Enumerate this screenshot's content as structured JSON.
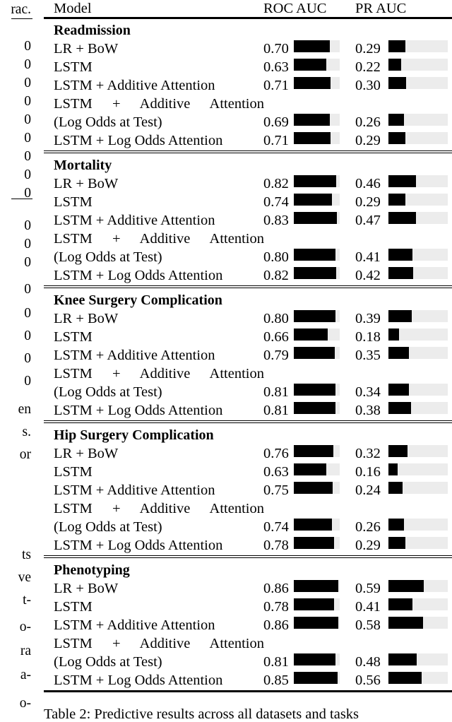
{
  "page": {
    "left_margin_column": {
      "header_fragment": "rac.",
      "value_fragments": [
        "0",
        "0",
        "0",
        "0",
        "0",
        "0",
        "0",
        "0",
        "0",
        "0",
        "0",
        "0",
        "0",
        "0",
        "0",
        "0",
        "0"
      ],
      "text_fragments": [
        "en",
        "s.",
        "or",
        "ts",
        "ve",
        "t-",
        "o-",
        "ra",
        "a-",
        "o-"
      ]
    },
    "caption": "Table 2: Predictive results across all datasets and tasks"
  },
  "table": {
    "columns": {
      "model": "Model",
      "roc_auc": "ROC AUC",
      "pr_auc": "PR AUC"
    },
    "bar_scale": {
      "roc_max": 0.885,
      "pr_max": 1.0,
      "track_color": "#ececec",
      "fill_color": "#000000"
    },
    "model_names": {
      "lr_bow": "LR + BoW",
      "lstm": "LSTM",
      "lstm_additive": "LSTM + Additive Attention",
      "lstm_additive_logodds_line1": "LSTM + Additive Attention",
      "lstm_additive_logodds_line2": "(Log Odds at Test)",
      "lstm_logodds": "LSTM + Log Odds Attention"
    },
    "sections": [
      {
        "title": "Readmission",
        "rows": [
          {
            "model": "LR + BoW",
            "roc": "0.70",
            "pr": "0.29"
          },
          {
            "model": "LSTM",
            "roc": "0.63",
            "pr": "0.22"
          },
          {
            "model": "LSTM + Additive Attention",
            "roc": "0.71",
            "pr": "0.30"
          },
          {
            "model": "LSTM + Additive Attention (Log Odds at Test)",
            "roc": "0.69",
            "pr": "0.26"
          },
          {
            "model": "LSTM + Log Odds Attention",
            "roc": "0.71",
            "pr": "0.29"
          }
        ]
      },
      {
        "title": "Mortality",
        "rows": [
          {
            "model": "LR + BoW",
            "roc": "0.82",
            "pr": "0.46"
          },
          {
            "model": "LSTM",
            "roc": "0.74",
            "pr": "0.29"
          },
          {
            "model": "LSTM + Additive Attention",
            "roc": "0.83",
            "pr": "0.47"
          },
          {
            "model": "LSTM + Additive Attention (Log Odds at Test)",
            "roc": "0.80",
            "pr": "0.41"
          },
          {
            "model": "LSTM + Log Odds Attention",
            "roc": "0.82",
            "pr": "0.42"
          }
        ]
      },
      {
        "title": "Knee Surgery Complication",
        "rows": [
          {
            "model": "LR + BoW",
            "roc": "0.80",
            "pr": "0.39"
          },
          {
            "model": "LSTM",
            "roc": "0.66",
            "pr": "0.18"
          },
          {
            "model": "LSTM + Additive Attention",
            "roc": "0.79",
            "pr": "0.35"
          },
          {
            "model": "LSTM + Additive Attention (Log Odds at Test)",
            "roc": "0.81",
            "pr": "0.34"
          },
          {
            "model": "LSTM + Log Odds Attention",
            "roc": "0.81",
            "pr": "0.38"
          }
        ]
      },
      {
        "title": "Hip Surgery Complication",
        "rows": [
          {
            "model": "LR + BoW",
            "roc": "0.76",
            "pr": "0.32"
          },
          {
            "model": "LSTM",
            "roc": "0.63",
            "pr": "0.16"
          },
          {
            "model": "LSTM + Additive Attention",
            "roc": "0.75",
            "pr": "0.24"
          },
          {
            "model": "LSTM + Additive Attention (Log Odds at Test)",
            "roc": "0.74",
            "pr": "0.26"
          },
          {
            "model": "LSTM + Log Odds Attention",
            "roc": "0.78",
            "pr": "0.29"
          }
        ]
      },
      {
        "title": "Phenotyping",
        "rows": [
          {
            "model": "LR + BoW",
            "roc": "0.86",
            "pr": "0.59"
          },
          {
            "model": "LSTM",
            "roc": "0.78",
            "pr": "0.41"
          },
          {
            "model": "LSTM + Additive Attention",
            "roc": "0.86",
            "pr": "0.58"
          },
          {
            "model": "LSTM + Additive Attention (Log Odds at Test)",
            "roc": "0.81",
            "pr": "0.48"
          },
          {
            "model": "LSTM + Log Odds Attention",
            "roc": "0.85",
            "pr": "0.56"
          }
        ]
      }
    ]
  },
  "chart_data": {
    "type": "bar",
    "title": "Predictive results across all datasets and tasks",
    "xlabel": "",
    "ylabel": "",
    "categories": [
      "Readmission / LR + BoW",
      "Readmission / LSTM",
      "Readmission / LSTM + Additive Attention",
      "Readmission / LSTM + Additive Attention (Log Odds at Test)",
      "Readmission / LSTM + Log Odds Attention",
      "Mortality / LR + BoW",
      "Mortality / LSTM",
      "Mortality / LSTM + Additive Attention",
      "Mortality / LSTM + Additive Attention (Log Odds at Test)",
      "Mortality / LSTM + Log Odds Attention",
      "Knee Surgery Complication / LR + BoW",
      "Knee Surgery Complication / LSTM",
      "Knee Surgery Complication / LSTM + Additive Attention",
      "Knee Surgery Complication / LSTM + Additive Attention (Log Odds at Test)",
      "Knee Surgery Complication / LSTM + Log Odds Attention",
      "Hip Surgery Complication / LR + BoW",
      "Hip Surgery Complication / LSTM",
      "Hip Surgery Complication / LSTM + Additive Attention",
      "Hip Surgery Complication / LSTM + Additive Attention (Log Odds at Test)",
      "Hip Surgery Complication / LSTM + Log Odds Attention",
      "Phenotyping / LR + BoW",
      "Phenotyping / LSTM",
      "Phenotyping / LSTM + Additive Attention",
      "Phenotyping / LSTM + Additive Attention (Log Odds at Test)",
      "Phenotyping / LSTM + Log Odds Attention"
    ],
    "series": [
      {
        "name": "ROC AUC",
        "values": [
          0.7,
          0.63,
          0.71,
          0.69,
          0.71,
          0.82,
          0.74,
          0.83,
          0.8,
          0.82,
          0.8,
          0.66,
          0.79,
          0.81,
          0.81,
          0.76,
          0.63,
          0.75,
          0.74,
          0.78,
          0.86,
          0.78,
          0.86,
          0.81,
          0.85
        ]
      },
      {
        "name": "PR AUC",
        "values": [
          0.29,
          0.22,
          0.3,
          0.26,
          0.29,
          0.46,
          0.29,
          0.47,
          0.41,
          0.42,
          0.39,
          0.18,
          0.35,
          0.34,
          0.38,
          0.32,
          0.16,
          0.24,
          0.26,
          0.29,
          0.59,
          0.41,
          0.58,
          0.48,
          0.56
        ]
      }
    ],
    "grid": false,
    "legend": "none"
  }
}
